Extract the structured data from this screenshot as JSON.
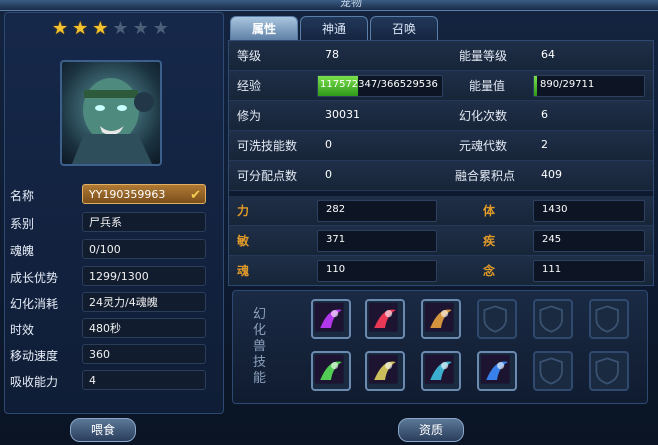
{
  "header": {
    "title": "宠物"
  },
  "tabs": [
    {
      "label": "属性",
      "active": true
    },
    {
      "label": "神通",
      "active": false
    },
    {
      "label": "召唤",
      "active": false
    }
  ],
  "pet": {
    "stars_on": 3,
    "stars_total": 6,
    "name_label": "名称",
    "name_value": "YY190359963",
    "info": [
      {
        "label": "系别",
        "value": "尸兵系"
      },
      {
        "label": "魂魄",
        "value": "0/100"
      },
      {
        "label": "成长优势",
        "value": "1299/1300"
      },
      {
        "label": "幻化消耗",
        "value": "24灵力/4魂魄"
      },
      {
        "label": "时效",
        "value": "480秒"
      },
      {
        "label": "移动速度",
        "value": "360"
      },
      {
        "label": "吸收能力",
        "value": "4"
      }
    ]
  },
  "stats": {
    "level": {
      "label": "等级",
      "value": "78"
    },
    "energy_level": {
      "label": "能量等级",
      "value": "64"
    },
    "exp": {
      "label": "经验",
      "value": "117572347/366529536",
      "fill": 0.32
    },
    "energy": {
      "label": "能量值",
      "value": "890/29711",
      "fill": 0.03
    },
    "cultivation": {
      "label": "修为",
      "value": "30031"
    },
    "transform_count": {
      "label": "幻化次数",
      "value": "6"
    },
    "washable_skills": {
      "label": "可洗技能数",
      "value": "0"
    },
    "soul_gen": {
      "label": "元魂代数",
      "value": "2"
    },
    "assign_points": {
      "label": "可分配点数",
      "value": "0"
    },
    "fusion_points": {
      "label": "融合累积点",
      "value": "409"
    },
    "attrs": [
      {
        "label": "力",
        "value": "282"
      },
      {
        "label": "体",
        "value": "1430"
      },
      {
        "label": "敏",
        "value": "371"
      },
      {
        "label": "疾",
        "value": "245"
      },
      {
        "label": "魂",
        "value": "110"
      },
      {
        "label": "念",
        "value": "111"
      }
    ]
  },
  "skills": {
    "title": "幻化兽技能",
    "slots": [
      {
        "icon": "purple-claw-icon",
        "color": "#c23cff"
      },
      {
        "icon": "red-slash-icon",
        "color": "#ff3c5a"
      },
      {
        "icon": "golden-flame-icon",
        "color": "#e8a040"
      },
      {
        "icon": "empty-shield-icon",
        "color": ""
      },
      {
        "icon": "empty-shield-icon",
        "color": ""
      },
      {
        "icon": "empty-shield-icon",
        "color": ""
      },
      {
        "icon": "green-wind-icon",
        "color": "#5ae05a"
      },
      {
        "icon": "yellow-spikes-icon",
        "color": "#e0d060"
      },
      {
        "icon": "teal-mask-shield-icon",
        "color": "#40c0e0"
      },
      {
        "icon": "blue-swirl-shield-icon",
        "color": "#3c8cff"
      },
      {
        "icon": "empty-shield-icon",
        "color": ""
      },
      {
        "icon": "empty-shield-icon",
        "color": ""
      }
    ]
  },
  "buttons": {
    "feed": "喂食",
    "aptitude": "资质"
  }
}
